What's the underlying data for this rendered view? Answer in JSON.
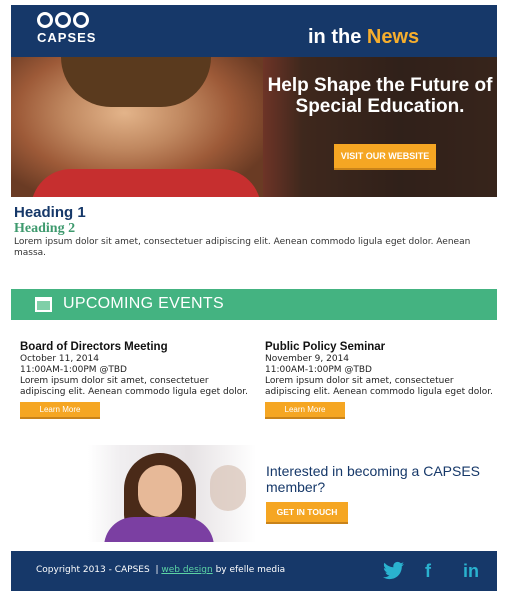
{
  "header": {
    "logo_text": "CAPSES",
    "title_prefix": "in the",
    "title_accent": "News"
  },
  "hero": {
    "tagline": "Help Shape the Future of Special Education.",
    "cta_label": "VISIT OUR WEBSITE"
  },
  "intro": {
    "heading1": "Heading 1",
    "heading2": "Heading 2",
    "body": "Lorem ipsum dolor sit amet, consectetuer adipiscing elit. Aenean commodo ligula eget dolor. Aenean massa."
  },
  "events": {
    "title": "UPCOMING EVENTS",
    "items": [
      {
        "title": "Board of Directors Meeting",
        "date": "October 11, 2014",
        "time": "11:00AM-1:00PM @TBD",
        "desc": "Lorem ipsum dolor sit amet, consectetuer adipiscing elit. Aenean commodo ligula eget dolor.",
        "button": "Learn More"
      },
      {
        "title": "Public Policy Seminar",
        "date": "November 9, 2014",
        "time": "11:00AM-1:00PM @TBD",
        "desc": "Lorem ipsum dolor sit amet, consectetuer adipiscing elit. Aenean commodo ligula eget dolor.",
        "button": "Learn More"
      }
    ]
  },
  "member": {
    "title": "Interested in becoming a CAPSES member?",
    "button": "GET IN TOUCH"
  },
  "footer": {
    "copyright": "Copyright 2013 - CAPSES",
    "separator": "|",
    "link_text": "web design",
    "credit": "by efelle media",
    "social": [
      "twitter-icon",
      "facebook-icon",
      "linkedin-icon"
    ]
  },
  "colors": {
    "navy": "#163869",
    "green": "#44b381",
    "orange": "#f5a623",
    "accent_yellow": "#f6ae2d"
  }
}
